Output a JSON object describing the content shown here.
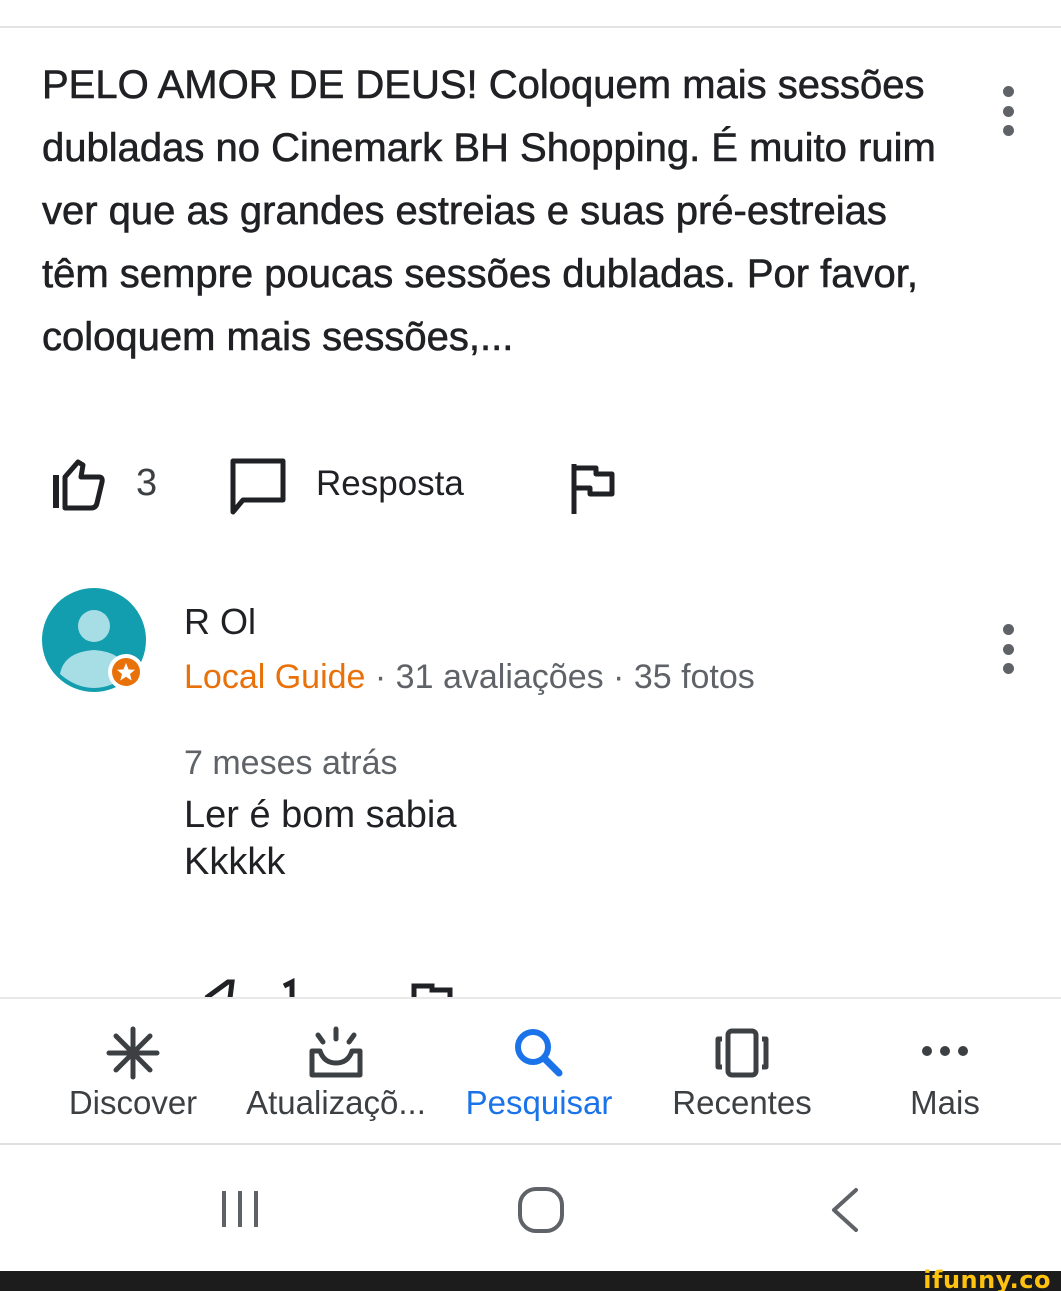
{
  "review": {
    "text": "PELO AMOR DE DEUS! Coloquem mais sessões dubladas no Cinemark BH Shopping. É muito ruim ver que as grandes estreias e suas pré-estreias têm sempre poucas sessões dubladas. Por favor, coloquem mais sessões,...",
    "likes": "3",
    "reply_label": "Resposta"
  },
  "reply": {
    "user_name": "R Ol",
    "badge_label": "Local Guide",
    "meta": " · 31 avaliações · 35 fotos",
    "time": "7 meses atrás",
    "body_line1": "Ler é bom sabia",
    "body_line2": "Kkkkk"
  },
  "bottom_nav": {
    "items": [
      {
        "label": "Discover",
        "icon": "discover-icon"
      },
      {
        "label": "Atualizaçõ...",
        "icon": "updates-icon"
      },
      {
        "label": "Pesquisar",
        "icon": "search-icon",
        "active": true
      },
      {
        "label": "Recentes",
        "icon": "recent-icon"
      },
      {
        "label": "Mais",
        "icon": "more-icon"
      }
    ]
  },
  "watermark": "ifunny.co",
  "colors": {
    "accent": "#1a73e8",
    "local_guide": "#e8710a",
    "avatar": "#129eaf",
    "icon_gray": "#5f6368"
  }
}
